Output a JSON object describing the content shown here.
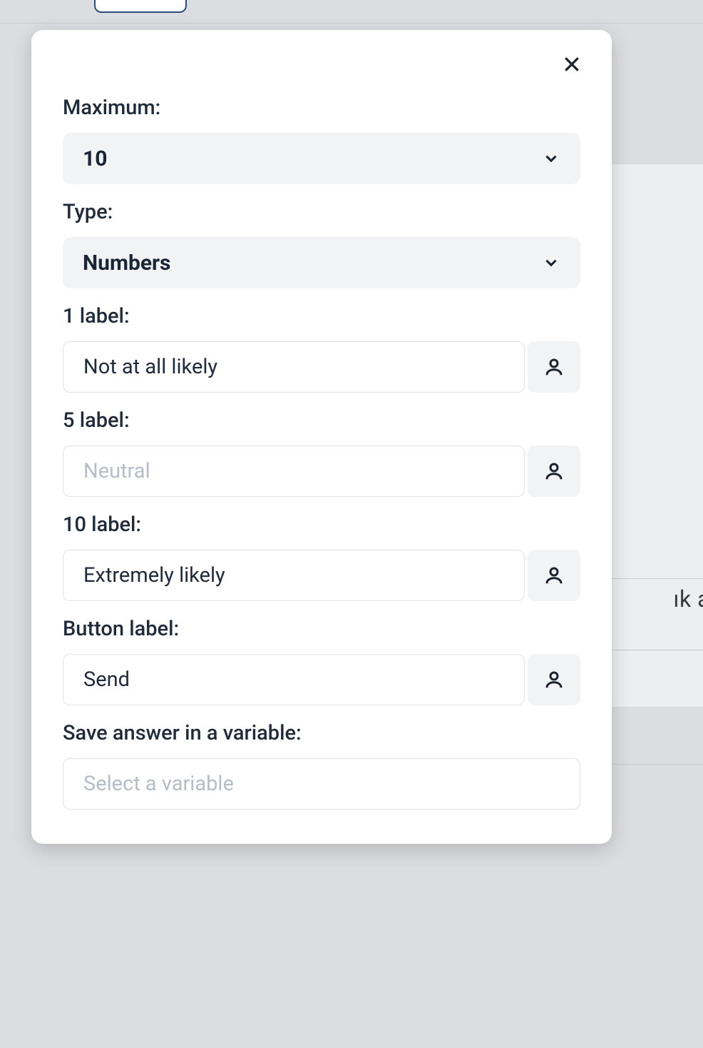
{
  "background": {
    "right_text": "ık a"
  },
  "modal": {
    "maximum": {
      "label": "Maximum:",
      "value": "10"
    },
    "type": {
      "label": "Type:",
      "value": "Numbers"
    },
    "label1": {
      "label": "1 label:",
      "value": "Not at all likely"
    },
    "label5": {
      "label": "5 label:",
      "value": "",
      "placeholder": "Neutral"
    },
    "label10": {
      "label": "10 label:",
      "value": "Extremely likely"
    },
    "buttonLabel": {
      "label": "Button label:",
      "value": "Send"
    },
    "saveVar": {
      "label": "Save answer in a variable:",
      "placeholder": "Select a variable"
    }
  }
}
